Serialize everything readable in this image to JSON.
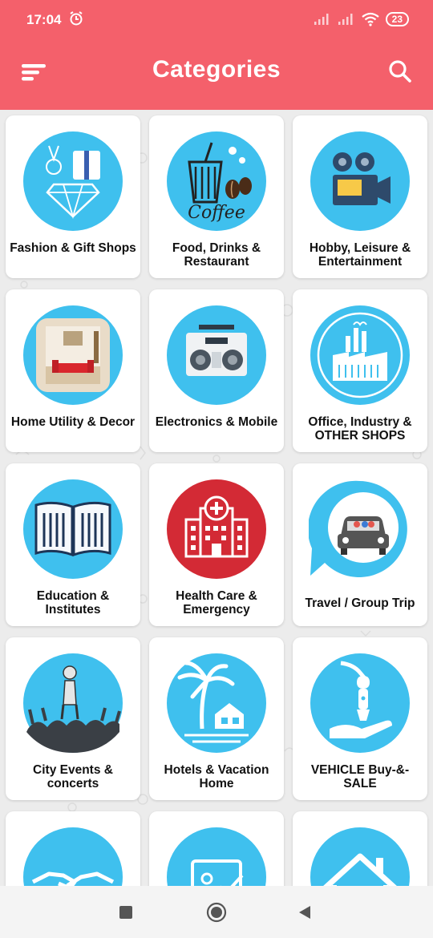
{
  "status": {
    "time": "17:04",
    "battery": "23"
  },
  "header": {
    "title": "Categories"
  },
  "categories": [
    {
      "label": "Fashion & Gift Shops",
      "icon": "fashion-gift-icon"
    },
    {
      "label": "Food, Drinks & Restaurant",
      "icon": "coffee-icon"
    },
    {
      "label": "Hobby, Leisure  & Entertainment",
      "icon": "projector-icon"
    },
    {
      "label": "Home Utility & Decor",
      "icon": "home-decor-icon"
    },
    {
      "label": "Electronics & Mobile",
      "icon": "boombox-icon"
    },
    {
      "label": "Office,  Industry & OTHER SHOPS",
      "icon": "factory-icon"
    },
    {
      "label": "Education & Institutes",
      "icon": "book-icon"
    },
    {
      "label": "Health Care & Emergency",
      "icon": "hospital-icon"
    },
    {
      "label": "Travel / Group Trip",
      "icon": "car-pin-icon"
    },
    {
      "label": "City Events & concerts",
      "icon": "concert-icon"
    },
    {
      "label": "Hotels & Vacation Home",
      "icon": "palm-hotel-icon"
    },
    {
      "label": "VEHICLE Buy-&-SALE",
      "icon": "car-key-icon"
    },
    {
      "label": "",
      "icon": "handshake-icon"
    },
    {
      "label": "",
      "icon": "document-check-icon"
    },
    {
      "label": "",
      "icon": "house-icon"
    }
  ],
  "colors": {
    "accent": "#f4606b",
    "icon_blue": "#3fc0ee",
    "health_red": "#d32a35"
  }
}
